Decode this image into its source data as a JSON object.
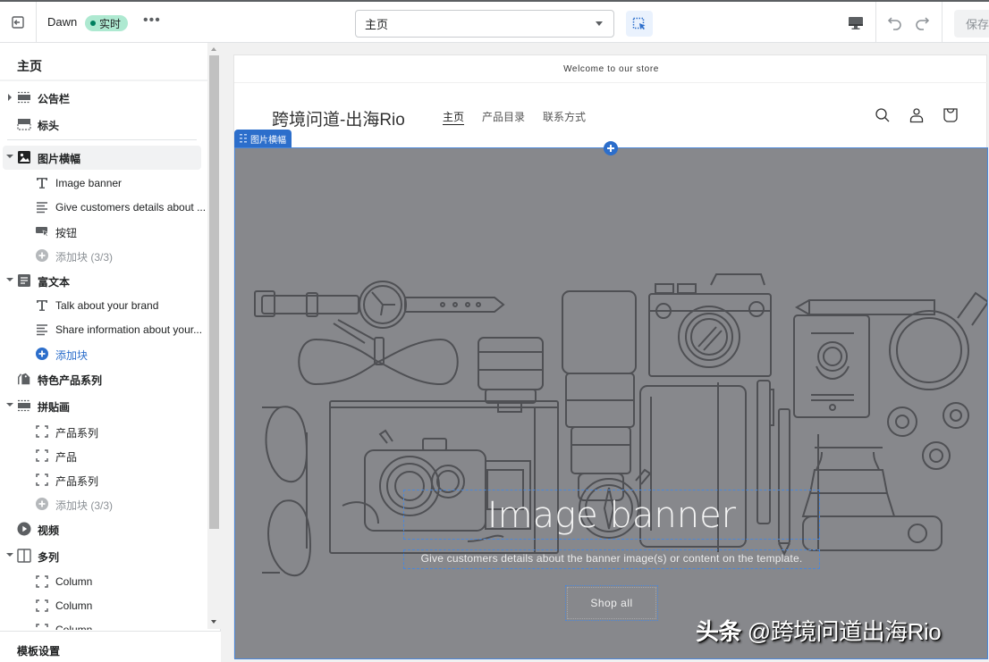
{
  "topbar": {
    "theme_name": "Dawn",
    "status_badge": "实时",
    "more_label": "•••",
    "page_select": "主页",
    "save_label": "保存"
  },
  "sidebar": {
    "title": "主页",
    "items": [
      {
        "label": "公告栏",
        "type": "section",
        "arrow": "right",
        "icon": "announcement-bar-icon"
      },
      {
        "label": "标头",
        "type": "section",
        "arrow": "",
        "icon": "header-icon"
      },
      {
        "label": "图片横幅",
        "type": "section",
        "arrow": "down",
        "icon": "image-icon",
        "selected": true
      },
      {
        "label": "Image banner",
        "type": "block",
        "icon": "text-icon"
      },
      {
        "label": "Give customers details about ...",
        "type": "block",
        "icon": "paragraph-icon"
      },
      {
        "label": "按钮",
        "type": "block",
        "icon": "button-icon"
      },
      {
        "label": "添加块 (3/3)",
        "type": "add-disabled",
        "icon": "add-circle-icon"
      },
      {
        "label": "富文本",
        "type": "section",
        "arrow": "down",
        "icon": "rich-text-icon"
      },
      {
        "label": "Talk about your brand",
        "type": "block",
        "icon": "text-icon"
      },
      {
        "label": "Share information about your...",
        "type": "block",
        "icon": "paragraph-icon"
      },
      {
        "label": "添加块",
        "type": "add",
        "icon": "add-circle-icon"
      },
      {
        "label": "特色产品系列",
        "type": "section",
        "arrow": "",
        "icon": "tag-icon"
      },
      {
        "label": "拼贴画",
        "type": "section",
        "arrow": "down",
        "icon": "collage-icon"
      },
      {
        "label": "产品系列",
        "type": "block",
        "icon": "frame-icon"
      },
      {
        "label": "产品",
        "type": "block",
        "icon": "frame-icon"
      },
      {
        "label": "产品系列",
        "type": "block",
        "icon": "frame-icon"
      },
      {
        "label": "添加块 (3/3)",
        "type": "add-disabled",
        "icon": "add-circle-icon"
      },
      {
        "label": "视频",
        "type": "section",
        "arrow": "",
        "icon": "play-icon"
      },
      {
        "label": "多列",
        "type": "section",
        "arrow": "down",
        "icon": "columns-icon"
      },
      {
        "label": "Column",
        "type": "block",
        "icon": "frame-icon"
      },
      {
        "label": "Column",
        "type": "block",
        "icon": "frame-icon"
      },
      {
        "label": "Column",
        "type": "block",
        "icon": "frame-icon"
      }
    ],
    "footer": "模板设置"
  },
  "preview": {
    "announcement": "Welcome to our store",
    "store_name": "跨境问道-出海Rio",
    "nav": [
      "主页",
      "产品目录",
      "联系方式"
    ],
    "active_nav": 0,
    "banner_tag": "图片横幅",
    "banner_heading": "Image banner",
    "banner_text": "Give customers details about the banner image(s) or content on the template.",
    "banner_button": "Shop all"
  },
  "watermark": {
    "brand": "头条",
    "handle": "@跨境问道出海Rio"
  },
  "colors": {
    "accent": "#2c6ecb",
    "badge_bg": "#aee9d1",
    "badge_dot": "#007f5f",
    "banner_overlay": "#87888c"
  }
}
